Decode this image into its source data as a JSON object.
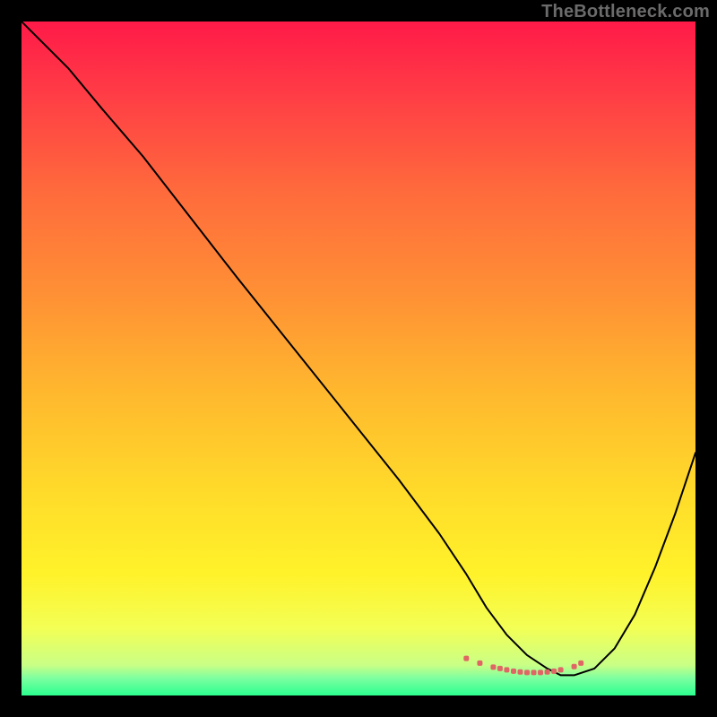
{
  "watermark": "TheBottleneck.com",
  "colors": {
    "curve": "#000000",
    "marker": "#e06666",
    "gradient_top": "#ff1a48",
    "gradient_bottom": "#2bff8f"
  },
  "chart_data": {
    "type": "line",
    "title": "",
    "xlabel": "",
    "ylabel": "",
    "xlim": [
      0,
      100
    ],
    "ylim": [
      0,
      100
    ],
    "x": [
      0,
      3,
      7,
      12,
      18,
      25,
      32,
      40,
      48,
      56,
      62,
      66,
      69,
      72,
      75,
      78,
      80,
      82,
      85,
      88,
      91,
      94,
      97,
      100
    ],
    "values": [
      100,
      97,
      93,
      87,
      80,
      71,
      62,
      52,
      42,
      32,
      24,
      18,
      13,
      9,
      6,
      4,
      3,
      3,
      4,
      7,
      12,
      19,
      27,
      36
    ],
    "markers_x": [
      66,
      68,
      70,
      71,
      72,
      73,
      74,
      75,
      76,
      77,
      78,
      79,
      80,
      82,
      83
    ],
    "markers_y": [
      5.5,
      4.8,
      4.2,
      4.0,
      3.8,
      3.6,
      3.5,
      3.4,
      3.4,
      3.4,
      3.5,
      3.6,
      3.8,
      4.3,
      4.8
    ],
    "marker_size": 6
  }
}
